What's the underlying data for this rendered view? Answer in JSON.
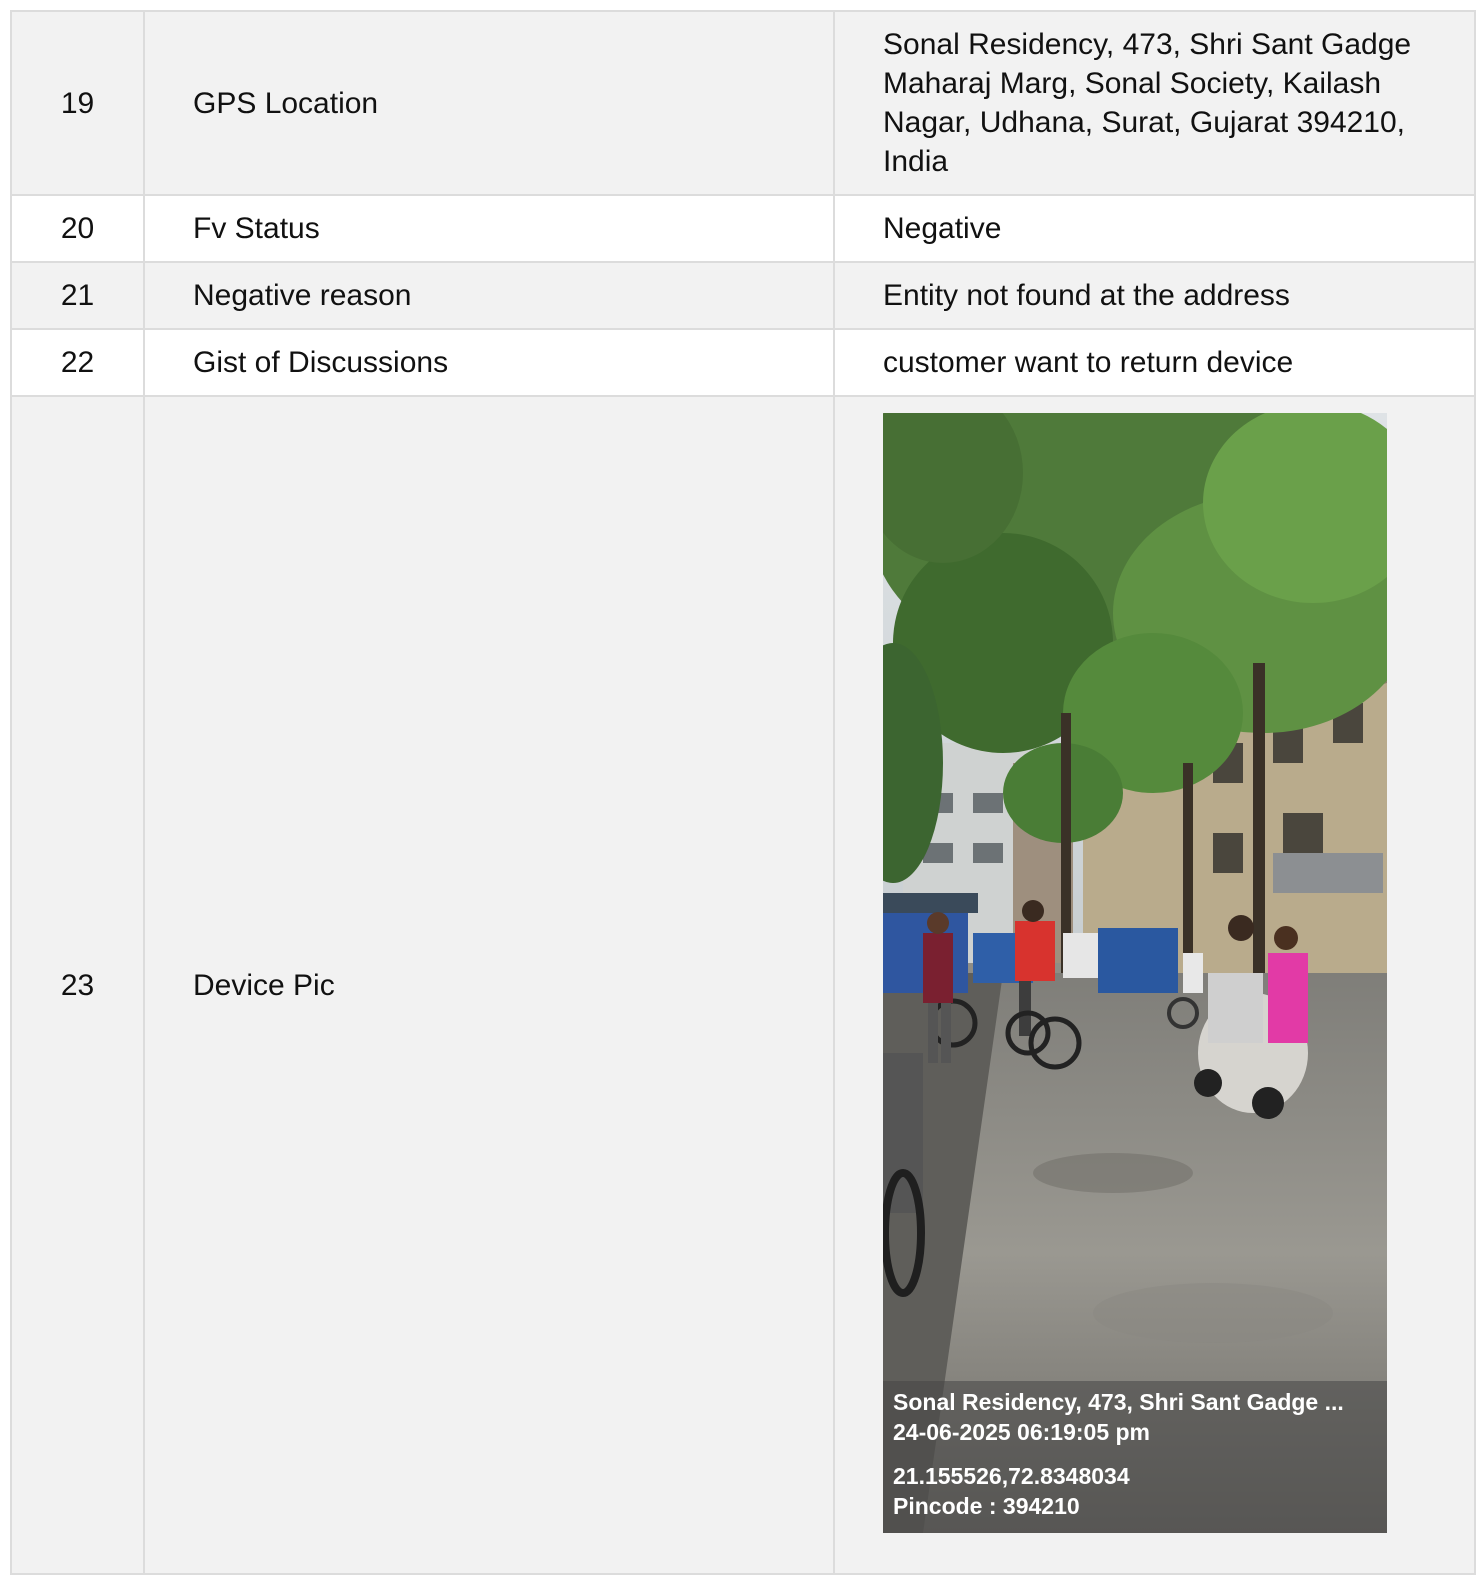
{
  "rows": [
    {
      "num": "19",
      "label": "GPS Location",
      "value": "Sonal Residency, 473, Shri Sant Gadge Maharaj Marg, Sonal Society, Kailash Nagar, Udhana, Surat, Gujarat 394210, India"
    },
    {
      "num": "20",
      "label": "Fv Status",
      "value": "Negative"
    },
    {
      "num": "21",
      "label": "Negative reason",
      "value": "Entity not found at the address"
    },
    {
      "num": "22",
      "label": "Gist of Discussions",
      "value": "customer want to return device"
    },
    {
      "num": "23",
      "label": "Device Pic"
    }
  ],
  "device_pic": {
    "address_line": "Sonal Residency, 473, Shri Sant Gadge ...",
    "datetime": "24-06-2025 06:19:05 pm",
    "coordinates": "21.155526,72.8348034",
    "pincode": "Pincode : 394210"
  }
}
